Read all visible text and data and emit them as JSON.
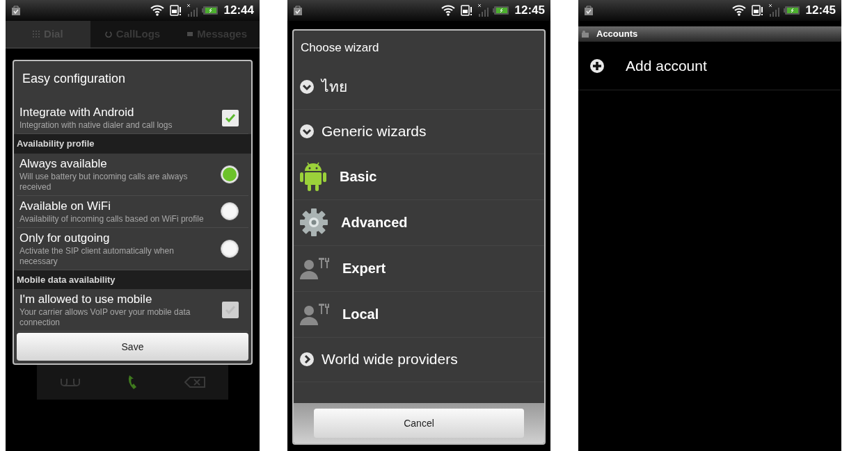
{
  "config_screen": {
    "status_bar": {
      "time": "12:44"
    },
    "tabs": [
      {
        "label": "Dial",
        "selected": true
      },
      {
        "label": "CallLogs",
        "selected": false
      },
      {
        "label": "Messages",
        "selected": false
      }
    ],
    "dialog": {
      "title": "Easy configuration",
      "items": [
        {
          "kind": "checkbox",
          "title": "Integrate with Android",
          "summary": "Integration with native dialer and call logs",
          "checked": true,
          "disabled": false
        },
        {
          "kind": "header",
          "label": "Availability profile"
        },
        {
          "kind": "radio",
          "title": "Always available",
          "summary": "Will use battery but incoming calls are always received",
          "selected": true
        },
        {
          "kind": "radio",
          "title": "Available on WiFi",
          "summary": "Availability of incoming calls based on WiFi profile",
          "selected": false
        },
        {
          "kind": "radio",
          "title": "Only for outgoing",
          "summary": "Activate the SIP client automatically when necessary",
          "selected": false
        },
        {
          "kind": "header",
          "label": "Mobile data availability"
        },
        {
          "kind": "checkbox",
          "title": "I'm allowed to use mobile",
          "summary": "Your carrier allows VoIP over your mobile data connection",
          "checked": true,
          "disabled": true
        }
      ],
      "button": "Save"
    }
  },
  "wizard_screen": {
    "status_bar": {
      "time": "12:45"
    },
    "dialog": {
      "title": "Choose wizard",
      "items": [
        {
          "kind": "category",
          "label": "ไทย",
          "expanded": true
        },
        {
          "kind": "category",
          "label": "Generic wizards",
          "expanded": true
        },
        {
          "kind": "android",
          "label": "Basic"
        },
        {
          "kind": "gear",
          "label": "Advanced"
        },
        {
          "kind": "tools",
          "label": "Expert"
        },
        {
          "kind": "tools",
          "label": "Local"
        },
        {
          "kind": "category",
          "label": "World wide providers",
          "expanded": false
        }
      ],
      "button": "Cancel"
    }
  },
  "accounts_screen": {
    "status_bar": {
      "time": "12:45"
    },
    "title": "Accounts",
    "items": [
      {
        "label": "Add account"
      }
    ]
  }
}
